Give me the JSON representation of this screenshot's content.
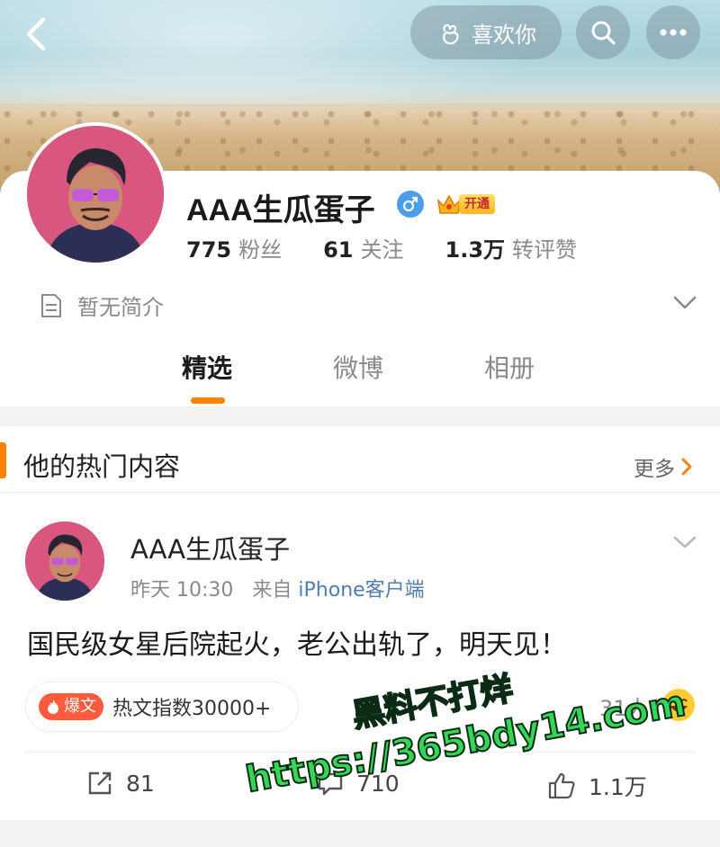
{
  "header": {
    "like_label": "喜欢你"
  },
  "profile": {
    "nickname": "AAA生瓜蛋子",
    "vip_label": "开通",
    "stats": [
      {
        "value": "775",
        "label": "粉丝"
      },
      {
        "value": "61",
        "label": "关注"
      },
      {
        "value": "1.3万",
        "label": "转评赞"
      }
    ],
    "bio": "暂无简介"
  },
  "tabs": [
    {
      "label": "精选",
      "active": true
    },
    {
      "label": "微博",
      "active": false
    },
    {
      "label": "相册",
      "active": false
    }
  ],
  "section": {
    "title": "他的热门内容",
    "more_label": "更多"
  },
  "post": {
    "author": "AAA生瓜蛋子",
    "time": "昨天 10:30",
    "from_prefix": "来自",
    "source": "iPhone客户端",
    "text": "国民级女星后院起火，老公出轨了，明天见！",
    "hot_tag": "爆文",
    "hot_label": "热文指数30000+",
    "likers": "31人",
    "actions": {
      "repost_count": "81",
      "comment_count": "710",
      "like_count": "1.1万"
    }
  },
  "watermark": {
    "line1": "黑料不打烊",
    "line2": "https://365bdy14.com"
  },
  "colors": {
    "accent": "#ff8200",
    "link": "#507daf",
    "hot_tag": "#ff5a3c",
    "male": "#4a9de8"
  },
  "icons": [
    "back-icon",
    "like-gesture-icon",
    "search-icon",
    "more-dots-icon",
    "male-icon",
    "crown-icon",
    "document-icon",
    "chevron-down-icon",
    "chevron-right-icon",
    "fire-icon",
    "smile-emoji-icon",
    "repost-icon",
    "comment-icon",
    "thumbs-up-icon"
  ]
}
